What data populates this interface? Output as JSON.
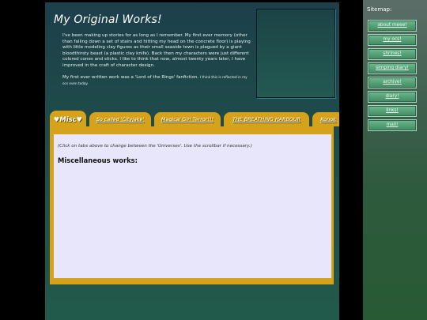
{
  "main": {
    "title": "My Original Works!",
    "paragraph1": "I've been making up stories for as long as I remember. My first ever memory (other than falling down a set of stairs and hitting my head on the concrete floor) is playing with little modeling clay figures as their small seaside town is plagued by a giant bloodthirsty beast (a plastic clay knife). Back then my characters were just different colored cones and sticks. I like to think that now, almost twenty years later, I have improved in the craft of character design.",
    "paragraph2": "My first ever written work was a 'Lord of the Rings' fanfiction.",
    "paragraph2_small": "I think this is reflected in my ocs even today."
  },
  "tabs": [
    {
      "label": "♥Misc♥",
      "active": true
    },
    {
      "label": "So called 'Cityjake'",
      "active": false
    },
    {
      "label": "Magical Girl Terror!!!",
      "active": false
    },
    {
      "label": "THE BREATHING HARBOUR",
      "active": false
    },
    {
      "label": "Konok",
      "active": false
    }
  ],
  "panel": {
    "hint": "(Click on tabs above to change between the 'Universes'. Use the scrollbar if necessary.)",
    "heading": "Miscellaneous works:"
  },
  "sidebar": {
    "label": "Sitemap:",
    "links": [
      "about meee!",
      "my ocs!",
      "shrines!",
      "simping diary!",
      "archive!",
      "diary!",
      "links!",
      "mail!"
    ]
  },
  "colors": {
    "tab_gold": "#d6a219",
    "panel_bg": "#e8e6fb",
    "nav_button": "#5aa47a"
  }
}
